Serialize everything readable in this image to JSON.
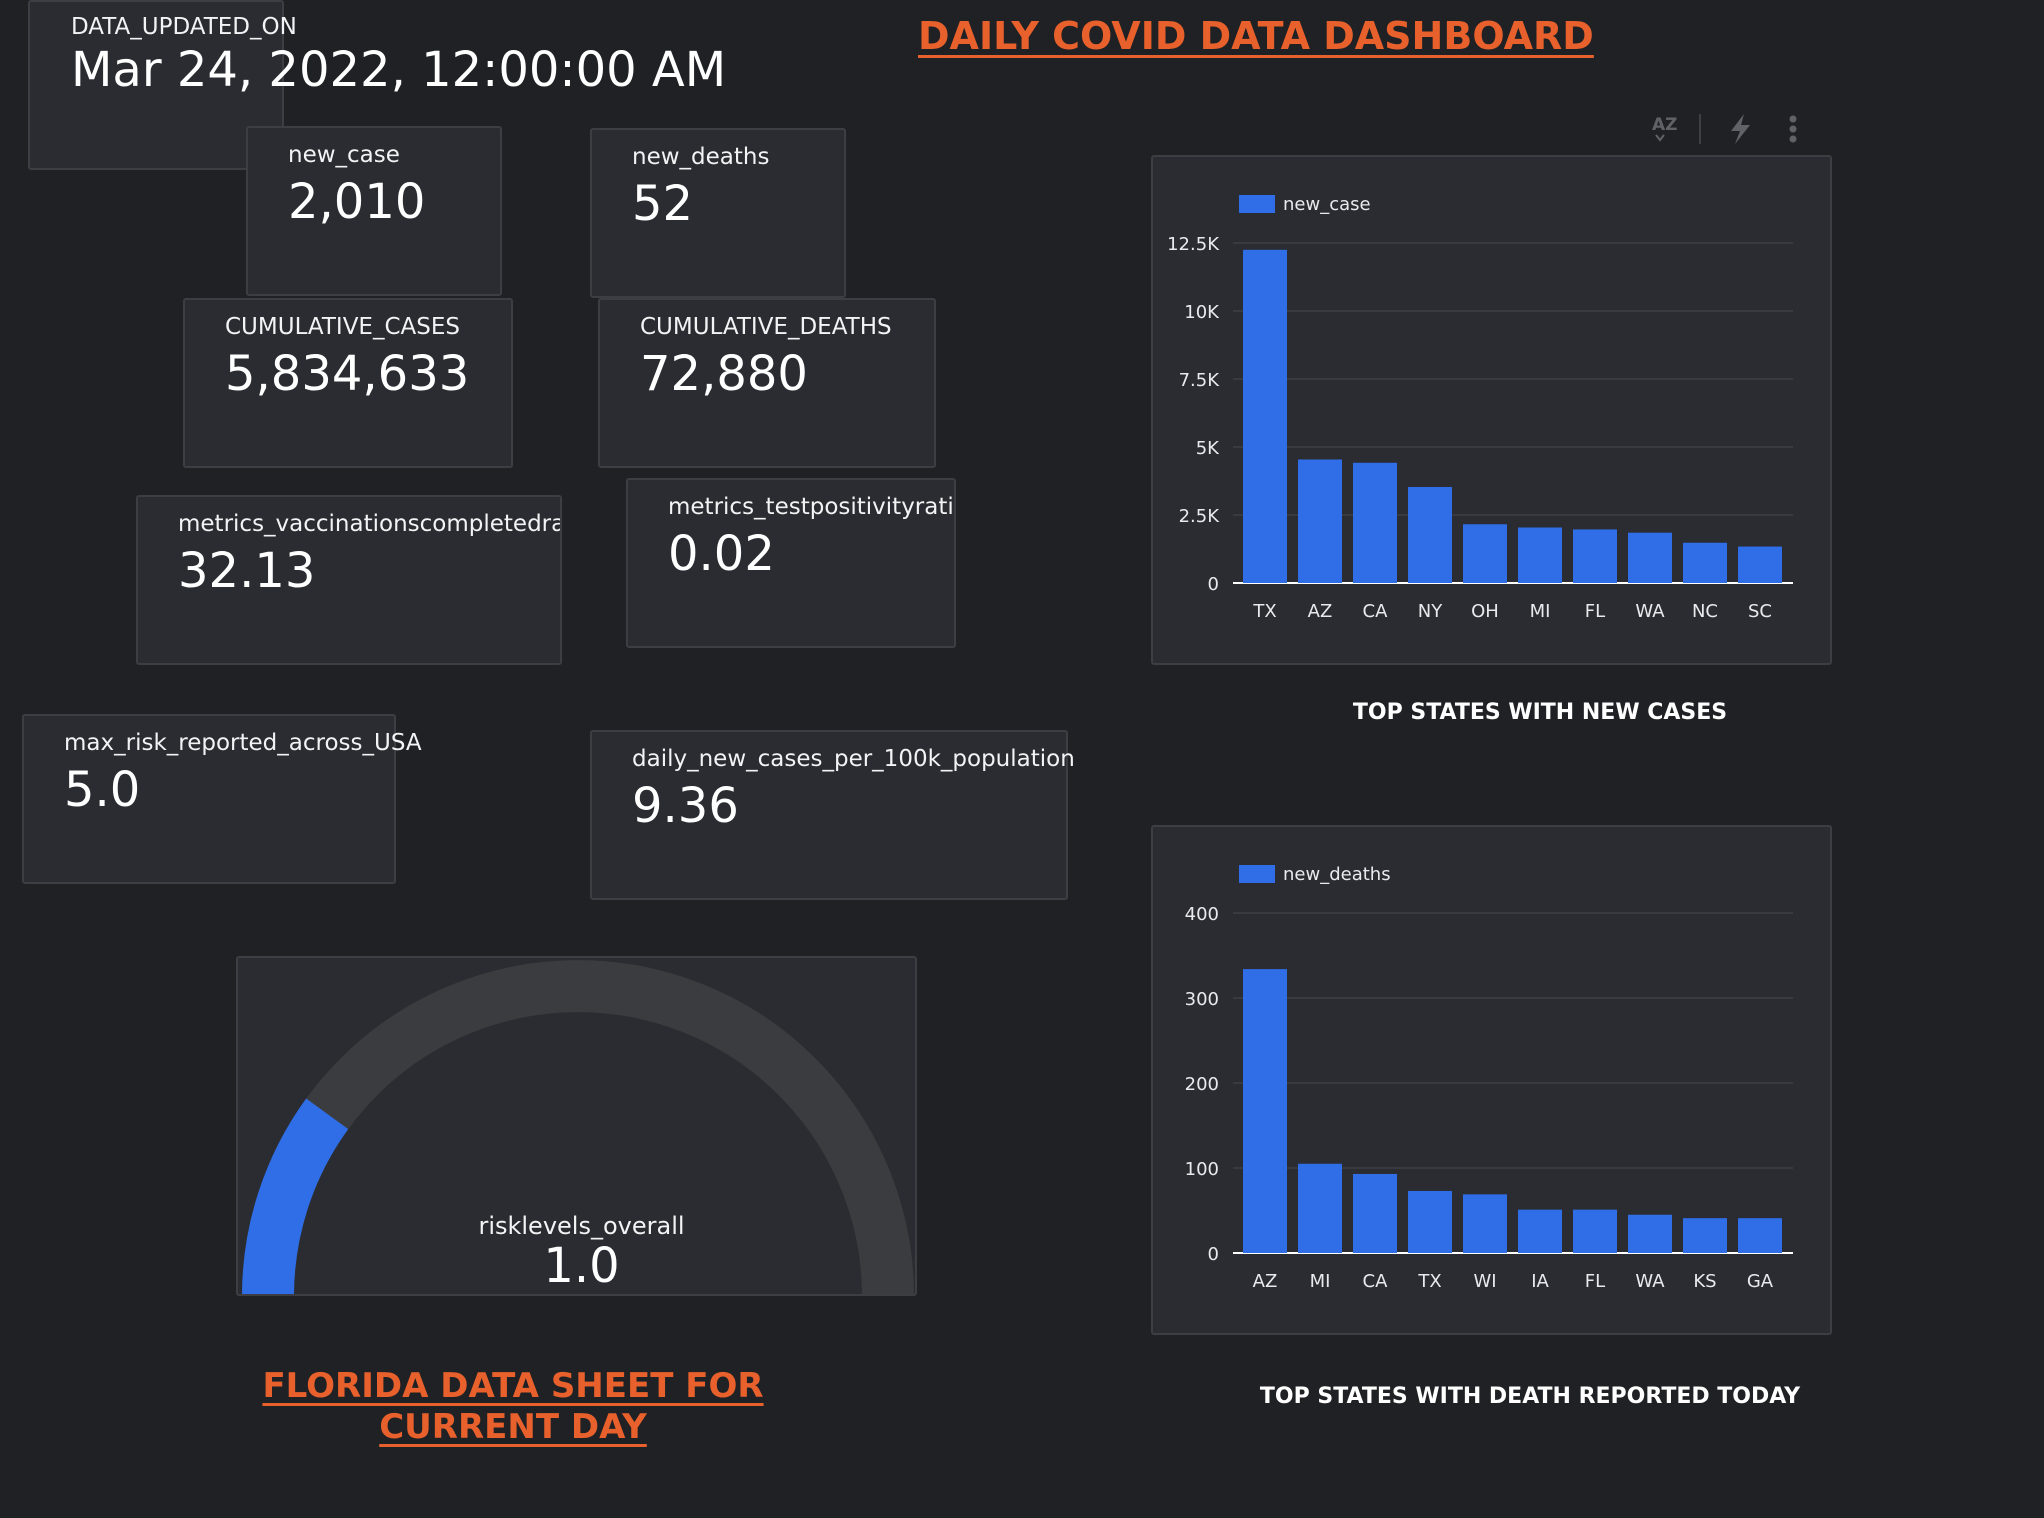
{
  "header": {
    "title": "DAILY COVID DATA DASHBOARD"
  },
  "toolbar": {
    "sort_icon": "sort-az-icon",
    "insights_icon": "bolt-icon",
    "more_icon": "more-vert-icon"
  },
  "scorecards": {
    "updated": {
      "label": "DATA_UPDATED_ON",
      "value": "Mar 24, 2022, 12:00:00 AM"
    },
    "new_case": {
      "label": "new_case",
      "value": "2,010"
    },
    "new_deaths": {
      "label": "new_deaths",
      "value": "52"
    },
    "cumulative_cases": {
      "label": "CUMULATIVE_CASES",
      "value": "5,834,633"
    },
    "cumulative_deaths": {
      "label": "CUMULATIVE_DEATHS",
      "value": "72,880"
    },
    "vaccination": {
      "label": "metrics_vaccinationscompletedratio",
      "value": "32.13"
    },
    "test_positivity": {
      "label": "metrics_testpositivityratio",
      "value": "0.02"
    },
    "max_risk": {
      "label": "max_risk_reported_across_USA",
      "value": "5.0"
    },
    "per_100k": {
      "label": "daily_new_cases_per_100k_population",
      "value": "9.36"
    }
  },
  "gauge": {
    "label": "risklevels_overall",
    "value": "1.0",
    "min": 0,
    "max": 5,
    "level": 1.0,
    "fill_color": "#2f6ee6",
    "track_color": "#3a3c3f"
  },
  "florida": {
    "line1": "FLORIDA DATA SHEET FOR",
    "line2": "CURRENT DAY"
  },
  "colors": {
    "accent": "#e8612c",
    "bar": "#2f6ee6",
    "background": "#202124",
    "card": "#2a2c31"
  },
  "chart_titles": {
    "new_cases": "TOP STATES WITH NEW CASES",
    "new_deaths": "TOP STATES WITH DEATH REPORTED TODAY"
  },
  "chart_data": [
    {
      "type": "bar",
      "title": "TOP STATES WITH NEW CASES",
      "categories": [
        "TX",
        "AZ",
        "CA",
        "NY",
        "OH",
        "MI",
        "FL",
        "WA",
        "NC",
        "SC"
      ],
      "series": [
        {
          "name": "new_case",
          "values": [
            12250,
            4540,
            4420,
            3530,
            2160,
            2040,
            1970,
            1850,
            1480,
            1340
          ]
        }
      ],
      "yticks": [
        "0",
        "2.5K",
        "5K",
        "7.5K",
        "10K",
        "12.5K"
      ],
      "ytick_values": [
        0,
        2500,
        5000,
        7500,
        10000,
        12500
      ],
      "ylim": [
        0,
        12500
      ],
      "grid": true,
      "legend": "top-left"
    },
    {
      "type": "bar",
      "title": "TOP STATES WITH DEATH REPORTED TODAY",
      "categories": [
        "AZ",
        "MI",
        "CA",
        "TX",
        "WI",
        "IA",
        "FL",
        "WA",
        "KS",
        "GA"
      ],
      "series": [
        {
          "name": "new_deaths",
          "values": [
            334,
            105,
            93,
            73,
            69,
            51,
            51,
            45,
            41,
            41
          ]
        }
      ],
      "yticks": [
        "0",
        "100",
        "200",
        "300",
        "400"
      ],
      "ytick_values": [
        0,
        100,
        200,
        300,
        400
      ],
      "ylim": [
        0,
        400
      ],
      "grid": true,
      "legend": "top-left"
    }
  ]
}
